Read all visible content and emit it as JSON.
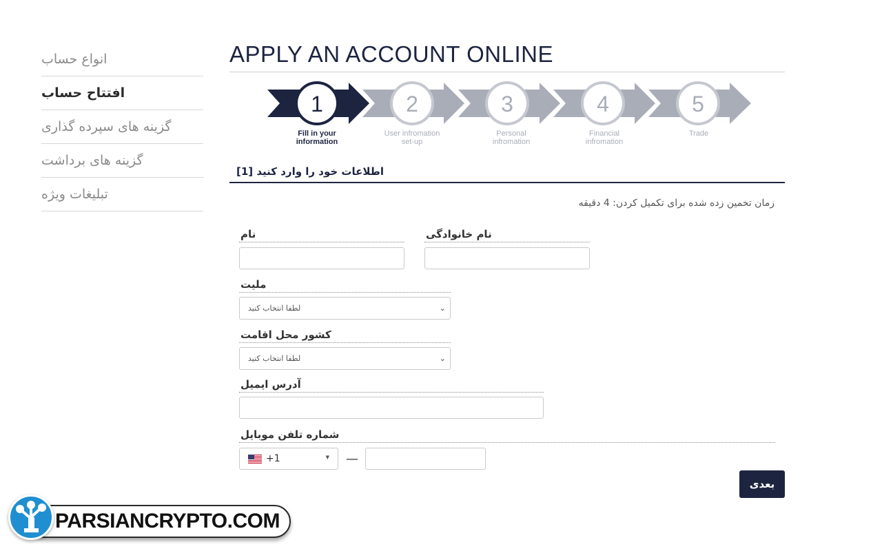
{
  "sidebar": {
    "items": [
      {
        "label": "انواع حساب"
      },
      {
        "label": "افتتاح حساب"
      },
      {
        "label": "گزینه های سپرده گذاری"
      },
      {
        "label": "گزینه های برداشت"
      },
      {
        "label": "تبلیغات ویژه"
      }
    ]
  },
  "page": {
    "title": "APPLY AN ACCOUNT ONLINE"
  },
  "steps": {
    "items": [
      {
        "number": "1",
        "label_line1": "Fill in your",
        "label_line2": "information"
      },
      {
        "number": "2",
        "label_line1": "User infromation",
        "label_line2": "set-up"
      },
      {
        "number": "3",
        "label_line1": "Personal",
        "label_line2": "infromation"
      },
      {
        "number": "4",
        "label_line1": "Financial",
        "label_line2": "infromation"
      },
      {
        "number": "5",
        "label_line1": "Trade",
        "label_line2": ""
      }
    ],
    "active_color": "#1d2440",
    "inactive_color": "#a9adb8"
  },
  "section": {
    "title": "اطلاعات خود را وارد کنید [1]"
  },
  "form": {
    "estimated_time": "زمان تخمین زده شده برای تکمیل کردن: 4 دقیقه",
    "first_name_label": "نام",
    "last_name_label": "نام خانوادگی",
    "nationality_label": "ملیت",
    "nationality_value": "لطفا انتخاب کنید",
    "residence_label": "کشور محل اقامت",
    "residence_value": "لطفا انتخاب کنید",
    "email_label": "آدرس ایمیل",
    "phone_label": "شماره تلفن موبایل",
    "phone_code": "+1",
    "phone_flag": "us-flag-icon",
    "next_label": "بعدی"
  },
  "watermark": {
    "text": "PARSIANCRYPTO.COM"
  }
}
